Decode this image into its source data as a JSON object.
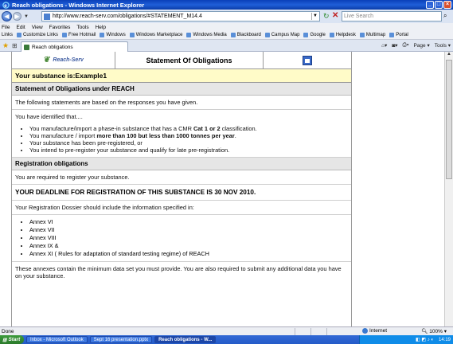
{
  "window": {
    "title": "Reach obligations - Windows Internet Explorer",
    "controls": [
      "_",
      "□",
      "×"
    ]
  },
  "address": {
    "url": "http://www.reach-serv.com/obligations/#STATEMENT_M14.4",
    "search_placeholder": "Live Search"
  },
  "menu": [
    "File",
    "Edit",
    "View",
    "Favorites",
    "Tools",
    "Help"
  ],
  "links": [
    "Links",
    "Customize Links",
    "Free Hotmail",
    "Windows",
    "Windows Marketplace",
    "Windows Media",
    "Blackboard",
    "Campus Map",
    "Google",
    "Helpdesk",
    "Multimap",
    "Portal"
  ],
  "tab": {
    "label": "Reach obligations"
  },
  "commands": [
    "Page",
    "Tools"
  ],
  "page": {
    "logo_text": "Reach-Serv",
    "header_title": "Statement Of Obligations",
    "substance_line": "Your substance is:Example1",
    "section1_title": "Statement of Obligations under REACH",
    "intro": "The following statements are based on the responses you have given.",
    "identified": "You have identified that....",
    "bullets1": {
      "b1_pre": "You manufacture/import a phase-in substance that has a CMR ",
      "b1_bold": "Cat 1 or 2",
      "b1_post": " classification.",
      "b2_pre": "You manufacture / import ",
      "b2_bold": "more than 100 but less than 1000 tonnes per year",
      "b2_post": ".",
      "b3": "Your substance has been pre-registered, or",
      "b4": "You intend to pre-register your substance and qualify for late pre-registration."
    },
    "section2_title": "Registration obligations",
    "required": "You are required to register your substance.",
    "deadline": "YOUR DEADLINE FOR REGISTRATION OF THIS SUBSTANCE IS 30 NOV 2010.",
    "dossier": "Your Registration Dossier should include the information specified in:",
    "annexes": [
      "Annex VI",
      "Annex VII",
      "Annex VIII",
      "Annex IX &",
      "Annex XI ( Rules for adaptation of standard testing regime) of REACH"
    ],
    "footer_text": "These annexes contain the minimum data set you must provide.  You are also required to submit any additional data you have on your substance."
  },
  "status": {
    "left": "Done",
    "zone": "Internet",
    "zoom": "100%"
  },
  "taskbar": {
    "start": "Start",
    "items": [
      "Inbox - Microsoft Outlook",
      "Sept 16 presentation.pptx",
      "Reach obligations - W..."
    ],
    "time": "14:19"
  }
}
